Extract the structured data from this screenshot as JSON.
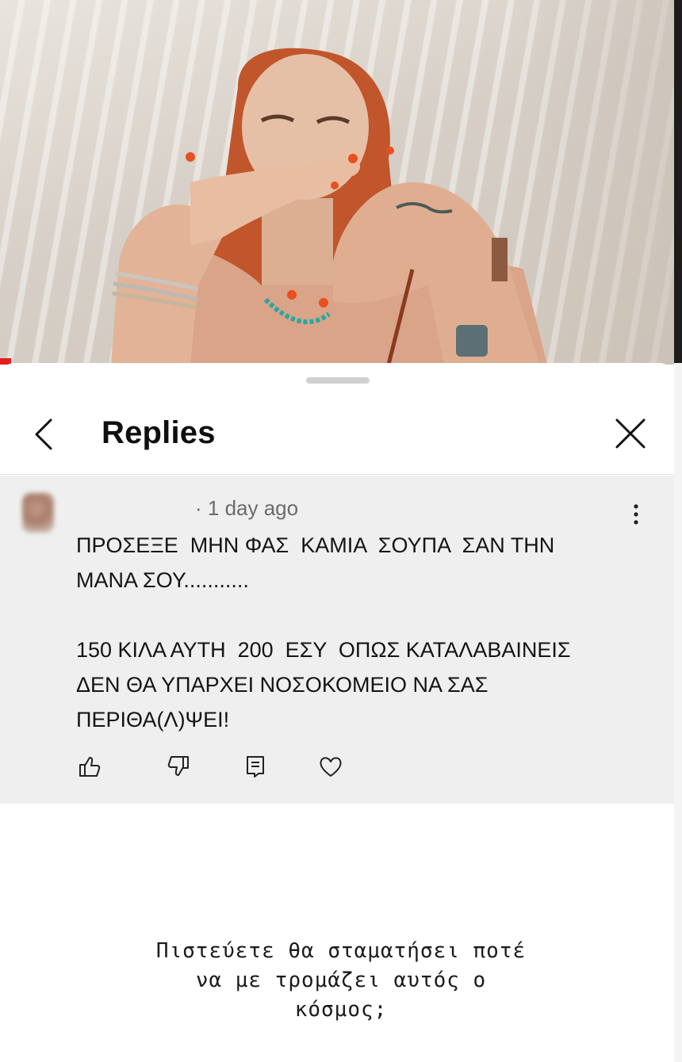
{
  "sheet": {
    "title": "Replies",
    "back_icon": "chevron-left-icon",
    "close_icon": "close-icon"
  },
  "comment": {
    "timestamp": "· 1 day ago",
    "text": "ΠΡΟΣΕΞΕ  ΜΗΝ ΦΑΣ  ΚΑΜΙΑ  ΣΟΥΠΑ  ΣΑΝ ΤΗΝ\nΜΑΝΑ ΣΟΥ...........\n\n150 ΚΙΛΑ ΑΥΤΗ  200  ΕΣΥ  ΟΠΩΣ ΚΑΤΑΛΑΒΑΙΝΕΙΣ\nΔΕΝ ΘΑ ΥΠΑΡΧΕΙ ΝΟΣΟΚΟΜΕΙΟ ΝΑ ΣΑΣ\nΠΕΡΙΘΑ(Λ)ΨΕΙ!",
    "actions": [
      "like-icon",
      "dislike-icon",
      "reply-icon",
      "heart-icon"
    ]
  },
  "caption": {
    "text": "Πιστεύετε θα σταματήσει ποτέ\nνα με τρομάζει αυτός ο\nκόσμος;"
  },
  "colors": {
    "accent_red": "#e0201e",
    "comment_bg": "#efefef",
    "text": "#0f0f0f",
    "muted": "#6b6b6b"
  }
}
